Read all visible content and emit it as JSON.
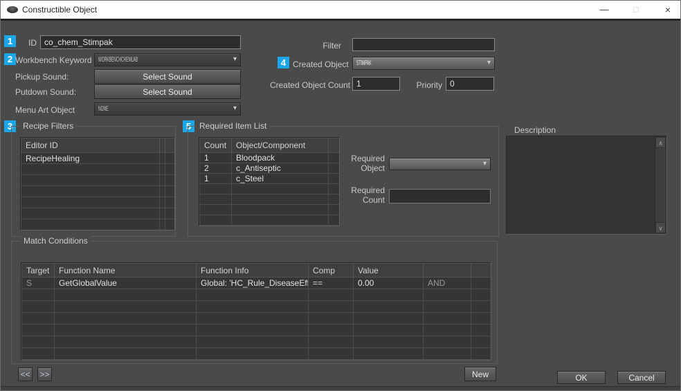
{
  "window": {
    "title": "Constructible Object",
    "controls": {
      "minimize": "—",
      "maximize": "□",
      "close": "×"
    },
    "icons": {
      "app_icon": "dark-saucer",
      "combo_arrow": "▾",
      "scroll_up": "∧",
      "scroll_down": "∨"
    }
  },
  "callouts": {
    "one": "1",
    "two": "2",
    "three": "3",
    "four": "4",
    "five": "5"
  },
  "colors": {
    "badge_blue": "#1ba6e8",
    "content_bg": "#4a4a4a",
    "table_bg": "#353535",
    "titlebar_bg": "#ffffff"
  },
  "form": {
    "id_label": "ID",
    "id_value": "co_chem_Stimpak",
    "workbench_keyword_label": "Workbench Keyword",
    "workbench_keyword_value": "WORKBENCHCHEMLAB",
    "pickup_sound_label": "Pickup Sound:",
    "pickup_sound_button": "Select Sound",
    "putdown_sound_label": "Putdown Sound:",
    "putdown_sound_button": "Select Sound",
    "menu_art_label": "Menu Art Object",
    "menu_art_value": "NONE",
    "filter_label": "Filter",
    "filter_value": "",
    "created_object_label": "Created Object",
    "created_object_value": "STIMPAK",
    "created_object_count_label": "Created Object Count",
    "created_object_count_value": "1",
    "priority_label": "Priority",
    "priority_value": "0"
  },
  "recipe_filters": {
    "title": "Recipe Filters",
    "columns": [
      "Editor ID"
    ],
    "rows": [
      [
        "RecipeHealing"
      ]
    ],
    "total_rows": 7
  },
  "required_item_list": {
    "title": "Required Item List",
    "columns": [
      "Count",
      "Object/Component"
    ],
    "rows": [
      [
        "1",
        "Bloodpack"
      ],
      [
        "2",
        "c_Antiseptic"
      ],
      [
        "1",
        "c_Steel"
      ]
    ],
    "total_rows": 7,
    "required_object_label": "Required Object",
    "required_object_value": "",
    "required_count_label": "Required Count",
    "required_count_value": ""
  },
  "description": {
    "label": "Description",
    "value": ""
  },
  "match_conditions": {
    "title": "Match Conditions",
    "columns": [
      "Target",
      "Function Name",
      "Function Info",
      "Comp",
      "Value",
      "",
      ""
    ],
    "rows": [
      [
        "S",
        "GetGlobalValue",
        "Global: 'HC_Rule_DiseaseEff...",
        "==",
        "0.00",
        "AND",
        ""
      ]
    ],
    "total_rows": 7
  },
  "footer": {
    "prev_button": "<<",
    "next_button": ">>",
    "new_button": "New",
    "ok_button": "OK",
    "cancel_button": "Cancel"
  }
}
